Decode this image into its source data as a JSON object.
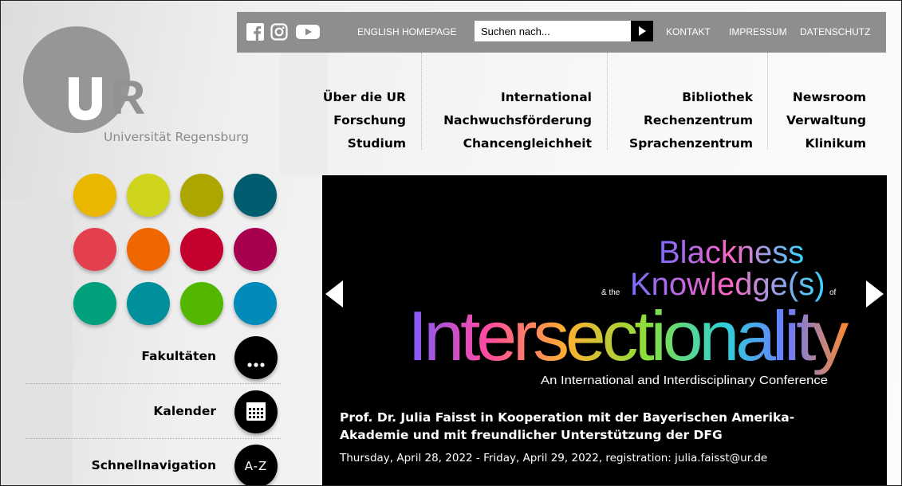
{
  "header": {
    "social": [
      "facebook-icon",
      "instagram-icon",
      "youtube-icon"
    ],
    "english": "ENGLISH HOMEPAGE",
    "search_placeholder": "Suchen nach...",
    "links": [
      "KONTAKT",
      "IMPRESSUM",
      "DATENSCHUTZ"
    ]
  },
  "logo": {
    "text": "UR",
    "name": "Universität Regensburg"
  },
  "nav": {
    "col1": [
      "Über die UR",
      "Forschung",
      "Studium"
    ],
    "col2": [
      "International",
      "Nachwuchsförderung",
      "Chancengleichheit"
    ],
    "col3": [
      "Bibliothek",
      "Rechenzentrum",
      "Sprachenzentrum"
    ],
    "col4": [
      "Newsroom",
      "Verwaltung",
      "Klinikum"
    ]
  },
  "color_dots": [
    "#e9b600",
    "#cfd41c",
    "#aea600",
    "#005c6e",
    "#e2404c",
    "#ee6700",
    "#c4002f",
    "#a6004e",
    "#00a07b",
    "#00909c",
    "#53b700",
    "#008bb9"
  ],
  "quick": [
    {
      "label": "Fakultäten",
      "icon": "more-dots-icon",
      "text": "..."
    },
    {
      "label": "Kalender",
      "icon": "calendar-icon",
      "text": ""
    },
    {
      "label": "Schnellnavigation",
      "icon": "a-z-icon",
      "text": "A-Z"
    }
  ],
  "slide": {
    "image": {
      "line1": "Blackness",
      "and_the": "& the",
      "line2": "Knowledge(s)",
      "of": "of",
      "line3": "Intersectionality",
      "subtitle": "An International and Interdisciplinary Conference"
    },
    "title": "Prof. Dr. Julia Faisst in Kooperation mit der Bayerischen Amerika-Akademie und mit freundlicher Unterstützung der DFG",
    "date": "Thursday, April 28, 2022 - Friday, April 29, 2022, registration: julia.faisst@ur.de"
  }
}
